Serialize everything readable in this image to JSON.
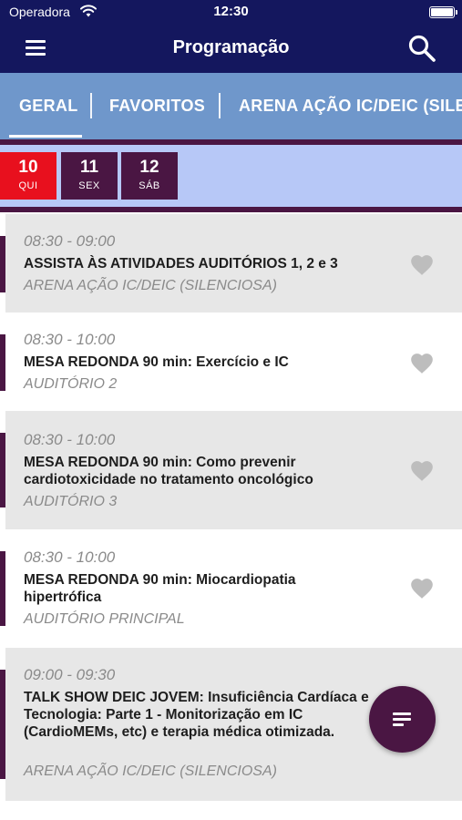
{
  "status_bar": {
    "carrier": "Operadora",
    "time": "12:30"
  },
  "header": {
    "title": "Programação"
  },
  "tabs": [
    {
      "label": "GERAL",
      "selected": true
    },
    {
      "label": "FAVORITOS",
      "selected": false
    },
    {
      "label": "ARENA AÇÃO IC/DEIC (SILENCIOSA)",
      "selected": false
    }
  ],
  "dates": [
    {
      "day": "10",
      "weekday": "QUI",
      "selected": true
    },
    {
      "day": "11",
      "weekday": "SEX",
      "selected": false
    },
    {
      "day": "12",
      "weekday": "SÁB",
      "selected": false
    }
  ],
  "sessions": [
    {
      "time": "08:30 - 09:00",
      "title": "ASSISTA ÀS ATIVIDADES AUDITÓRIOS 1, 2 e 3",
      "location": "ARENA AÇÃO IC/DEIC (SILENCIOSA)",
      "favorite": false
    },
    {
      "time": "08:30 - 10:00",
      "title": "MESA REDONDA 90 min: Exercício e IC",
      "location": "AUDITÓRIO 2",
      "favorite": false
    },
    {
      "time": "08:30 - 10:00",
      "title": "MESA REDONDA 90 min: Como prevenir cardiotoxicidade no tratamento oncológico",
      "location": "AUDITÓRIO 3",
      "favorite": false
    },
    {
      "time": "08:30 - 10:00",
      "title": "MESA REDONDA 90 min: Miocardiopatia hipertrófica",
      "location": "AUDITÓRIO PRINCIPAL",
      "favorite": false
    },
    {
      "time": "09:00 - 09:30",
      "title": "TALK SHOW DEIC JOVEM: Insuficiência Cardíaca e Tecnologia: Parte 1 - Monitorização em IC (CardioMEMs, etc) e terapia médica otimizada.",
      "location": "ARENA AÇÃO IC/DEIC (SILENCIOSA)",
      "favorite": false
    }
  ],
  "icons": {
    "menu": "hamburger-menu-icon",
    "search": "search-icon",
    "favorite": "heart-icon",
    "filter": "filter-list-icon",
    "wifi": "wifi-icon",
    "battery": "battery-icon"
  },
  "colors": {
    "header_bg": "#14175e",
    "tab_bg": "#6f97cb",
    "date_bar_bg": "#b7c8f7",
    "accent_purple": "#4a1643",
    "selected_date": "#e8101e",
    "heart_gray": "#bdbdbd"
  }
}
